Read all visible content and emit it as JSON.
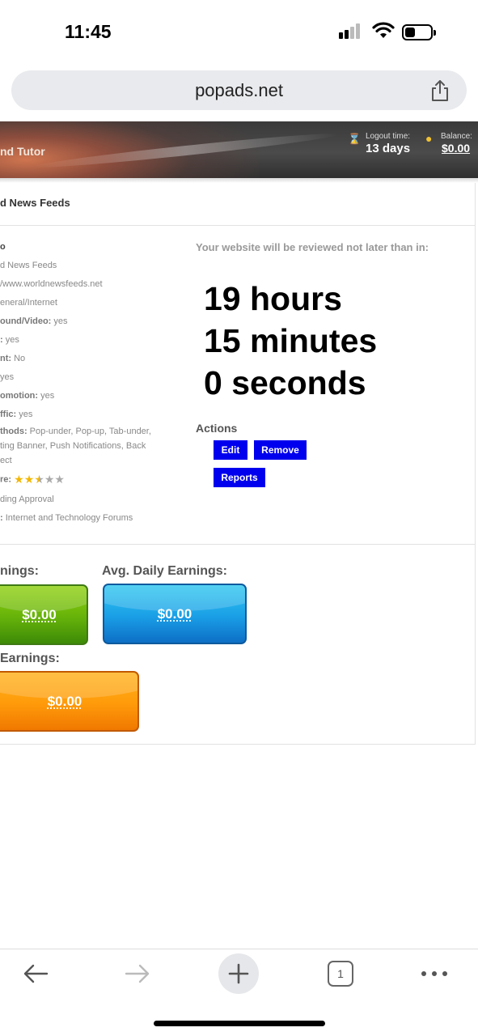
{
  "status_bar": {
    "time": "11:45"
  },
  "browser": {
    "url": "popads.net",
    "tab_count": "1"
  },
  "header": {
    "site_name": "nd Tutor",
    "logout_label": "Logout time:",
    "logout_value": "13 days",
    "balance_label": "Balance:",
    "balance_value": "$0.00"
  },
  "page": {
    "title": "d News Feeds"
  },
  "website_info": {
    "heading": "o",
    "name": "d News Feeds",
    "url": "/www.worldnewsfeeds.net",
    "category": "eneral/Internet",
    "sound_video_label": "ound/Video:",
    "sound_video_value": "yes",
    "row5_label": ":",
    "row5_value": "yes",
    "row6_label": "nt:",
    "row6_value": "No",
    "row7_value": "yes",
    "promotion_label": "omotion:",
    "promotion_value": "yes",
    "traffic_label": "ffic:",
    "traffic_value": "yes",
    "methods_label": "thods:",
    "methods_line1": "Pop-under, Pop-up, Tab-under,",
    "methods_line2": "ting Banner, Push Notifications, Back",
    "methods_line3": "ect",
    "score_label": "re:",
    "score_rating": 2.5,
    "score_max": 5,
    "status": "ding Approval",
    "topic_label": ":",
    "topic_value": "Internet and Technology Forums"
  },
  "review": {
    "text": "Your website will be reviewed not later than in:",
    "hours": "19 hours",
    "minutes": "15 minutes",
    "seconds": "0 seconds"
  },
  "actions": {
    "label": "Actions",
    "edit": "Edit",
    "remove": "Remove",
    "reports": "Reports"
  },
  "earnings": {
    "total_label": "nings:",
    "total_value": "$0.00",
    "avg_label": "Avg. Daily Earnings:",
    "avg_value": "$0.00",
    "third_label": "Earnings:",
    "third_value": "$0.00"
  },
  "colors": {
    "action_button": "#0000ee",
    "green_box": "#66b20a",
    "blue_box": "#1a9ee6",
    "orange_box": "#ff9a0a"
  },
  "toolbar": {
    "icons": [
      "back-arrow-icon",
      "forward-arrow-icon",
      "plus-icon",
      "tabs-icon",
      "more-icon"
    ]
  }
}
